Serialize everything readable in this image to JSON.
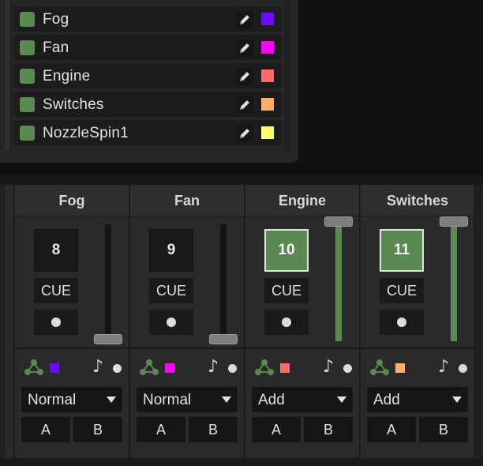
{
  "layers": [
    {
      "name": "Fog",
      "color": "#6a0dff",
      "icon": "pencil-icon"
    },
    {
      "name": "Fan",
      "color": "#ff00ff",
      "icon": "pencil-icon"
    },
    {
      "name": "Engine",
      "color": "#ff6a6a",
      "icon": "pencil-icon"
    },
    {
      "name": "Switches",
      "color": "#ffae6a",
      "icon": "pencil-icon"
    },
    {
      "name": "NozzleSpin1",
      "color": "#ffff6a",
      "icon": "pencil-icon"
    }
  ],
  "channels": [
    {
      "name": "Fog",
      "cue_number": "8",
      "cue_active": false,
      "cue_label": "CUE",
      "color": "#6a0dff",
      "fader_level": 0.0,
      "blend_mode": "Normal",
      "a_label": "A",
      "b_label": "B"
    },
    {
      "name": "Fan",
      "cue_number": "9",
      "cue_active": false,
      "cue_label": "CUE",
      "color": "#ff00ff",
      "fader_level": 0.0,
      "blend_mode": "Normal",
      "a_label": "A",
      "b_label": "B"
    },
    {
      "name": "Engine",
      "cue_number": "10",
      "cue_active": true,
      "cue_label": "CUE",
      "color": "#ff6a6a",
      "fader_level": 1.0,
      "blend_mode": "Add",
      "a_label": "A",
      "b_label": "B"
    },
    {
      "name": "Switches",
      "cue_number": "11",
      "cue_active": true,
      "cue_label": "CUE",
      "color": "#ffae6a",
      "fader_level": 1.0,
      "blend_mode": "Add",
      "a_label": "A",
      "b_label": "B"
    }
  ],
  "icons": {
    "routing": "routing-icon",
    "music": "music-note-icon"
  },
  "colors": {
    "active_green": "#5a8a52"
  }
}
